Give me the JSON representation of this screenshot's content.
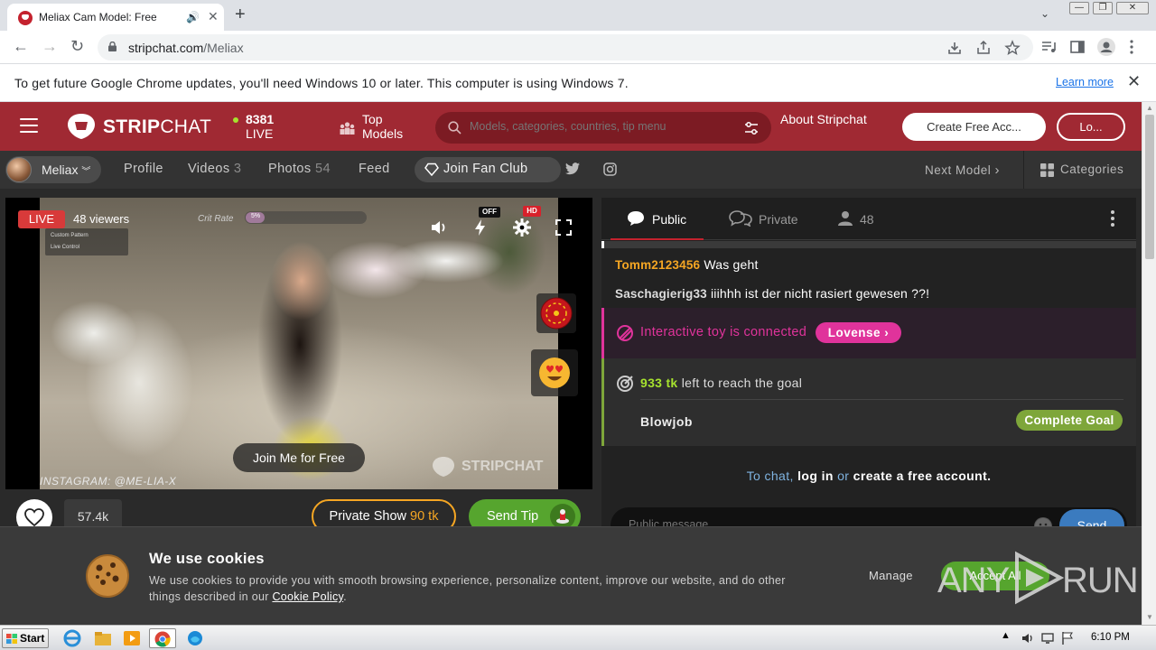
{
  "browser": {
    "tab_title": "Meliax Cam Model: Free Live Se",
    "url_host": "stripchat.com",
    "url_path": "/Meliax",
    "infobar_message": "To get future Google Chrome updates, you'll need Windows 10 or later. This computer is using Windows 7.",
    "infobar_link": "Learn more"
  },
  "header": {
    "logo_bold": "STRIP",
    "logo_thin": "CHAT",
    "live_count": "8381",
    "live_label": "LIVE",
    "top_models": "Top Models",
    "search_placeholder": "Models, categories, countries, tip menu",
    "about": "About Stripchat",
    "create_account": "Create Free Acc...",
    "login": "Lo..."
  },
  "model_bar": {
    "model_name": "Meliax",
    "profile": "Profile",
    "videos": "Videos",
    "videos_count": "3",
    "photos": "Photos",
    "photos_count": "54",
    "feed": "Feed",
    "join_fan_club": "Join Fan Club",
    "next_model": "Next Model",
    "categories": "Categories"
  },
  "video": {
    "live_badge": "LIVE",
    "viewers": "48 viewers",
    "overlay_row1": "Custom Pattern",
    "overlay_row2": "Live Control",
    "crit_rate_label": "Crit Rate",
    "crit_rate_value": "5%",
    "crit_rate_fraction": 0.16,
    "off_badge": "OFF",
    "hd_badge": "HD",
    "join_free": "Join Me for Free",
    "instagram": "INSTAGRAM: @ME-LIA-X",
    "watermark": "STRIPCHAT",
    "like_count": "57.4k",
    "private_show": "Private Show",
    "private_price": "90 tk",
    "send_tip": "Send Tip"
  },
  "chat": {
    "tabs": [
      {
        "label": "Public",
        "icon": "chat-bubble-icon"
      },
      {
        "label": "Private",
        "icon": "private-chat-icon"
      },
      {
        "label": "48",
        "icon": "users-icon"
      }
    ],
    "messages": [
      {
        "user": "Tomm2123456",
        "text": "Was geht"
      },
      {
        "user": "Saschagierig33",
        "text": "iiihhh ist der nicht rasiert gewesen ??!"
      }
    ],
    "toy_message": "Interactive toy is connected",
    "toy_button": "Lovense",
    "goal_tk": "933 tk",
    "goal_text": "left to reach the goal",
    "goal_name": "Blowjob",
    "complete_goal": "Complete Goal",
    "login_prompt_1": "To chat,",
    "login_prompt_2": "log in",
    "login_prompt_3": "or",
    "login_prompt_4": "create a free account.",
    "input_placeholder": "Public message...",
    "send": "Send"
  },
  "cookie": {
    "title": "We use cookies",
    "text": "We use cookies to provide you with smooth browsing experience, personalize content, improve our website, and do other things described in our",
    "policy_link": "Cookie Policy",
    "after": ".",
    "manage": "Manage",
    "accept": "Accept All"
  },
  "watermark_brand": {
    "left": "ANY",
    "right": "RUN"
  },
  "taskbar": {
    "start": "Start",
    "clock": "6:10 PM"
  },
  "colors": {
    "brand_red": "#a02933",
    "tip_green": "#56a52e",
    "lovense_pink": "#e0339b",
    "goal_green": "#7ea63a",
    "private_orange": "#f5a623",
    "send_blue": "#3b7bbf"
  }
}
